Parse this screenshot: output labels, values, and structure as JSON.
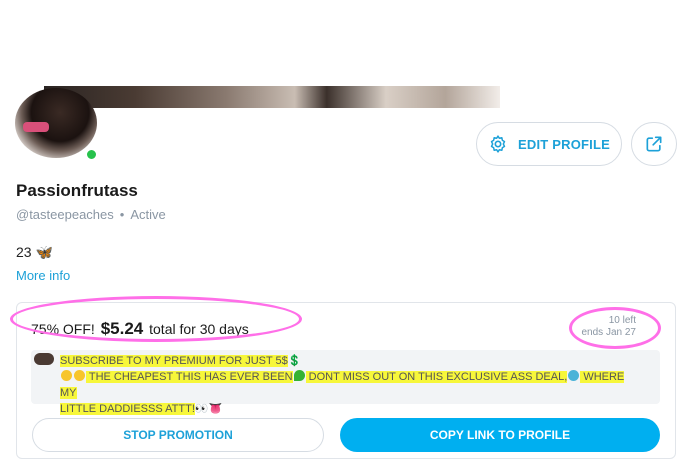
{
  "profile": {
    "display_name": "Passionfrutass",
    "handle": "@tasteepeaches",
    "status_dot": "•",
    "status": "Active",
    "bio": "23 🦋",
    "more_info_label": "More info"
  },
  "actions": {
    "edit_profile_label": "EDIT PROFILE",
    "settings_icon": "gear-icon",
    "share_icon": "share-icon"
  },
  "promotion": {
    "discount": "75% OFF!",
    "price": "$5.24",
    "duration": "total for 30 days",
    "left_count": "10 left",
    "ends": "ends Jan 27",
    "message_line1": "SUBSCRIBE TO MY PREMIUM FOR JUST 5$",
    "message_line1_emoji": "💲",
    "message_line2_a": " THE CHEAPEST THIS HAS EVER BEEN",
    "message_line2_b": " DONT MISS OUT ON THIS EXCLUSIVE ASS DEAL,",
    "message_line2_c": " WHERE MY",
    "message_line3": "LITTLE DADDIESSS ATTT!",
    "message_line3_emoji": "👀👅",
    "stop_label": "STOP PROMOTION",
    "copy_label": "COPY LINK TO PROFILE"
  },
  "colors": {
    "accent": "#00aff0",
    "link": "#1da1d8",
    "highlight": "#f7f73a",
    "circle_marker": "#ff6fe8",
    "online": "#27c24c"
  }
}
